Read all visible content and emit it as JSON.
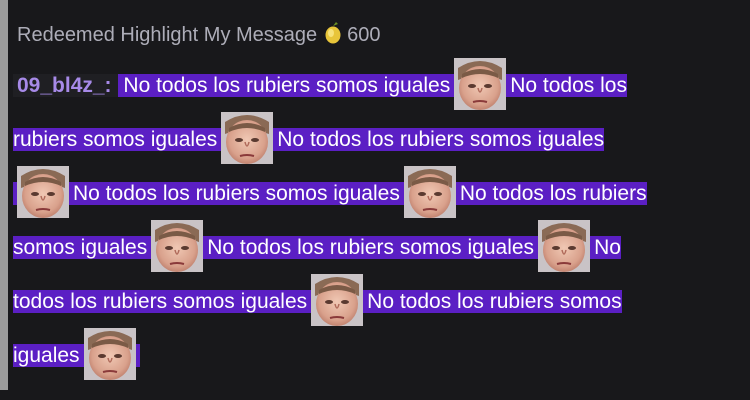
{
  "redemption": {
    "label": "Redeemed Highlight My Message",
    "cost": "600",
    "icon": "bits-coin-icon"
  },
  "message": {
    "username": "09_bl4z_:",
    "phrase": "No todos los rubiers somos iguales",
    "emote_name": "face-emote",
    "lines": [
      [
        "No todos los rubiers somos iguales",
        "EMOTE",
        "No todos los"
      ],
      [
        "rubiers somos iguales",
        "EMOTE",
        "No todos los rubiers somos iguales"
      ],
      [
        "EMOTE",
        "No todos los rubiers somos iguales",
        "EMOTE",
        "No todos los rubiers"
      ],
      [
        "somos iguales",
        "EMOTE",
        "No todos los rubiers somos iguales",
        "EMOTE",
        "No"
      ],
      [
        "todos los rubiers somos iguales",
        "EMOTE",
        "No todos los rubiers somos"
      ],
      [
        "iguales",
        "EMOTE"
      ]
    ]
  },
  "colors": {
    "highlight": "#5b1fc4",
    "username": "#a78ae8",
    "background": "#18181b"
  }
}
